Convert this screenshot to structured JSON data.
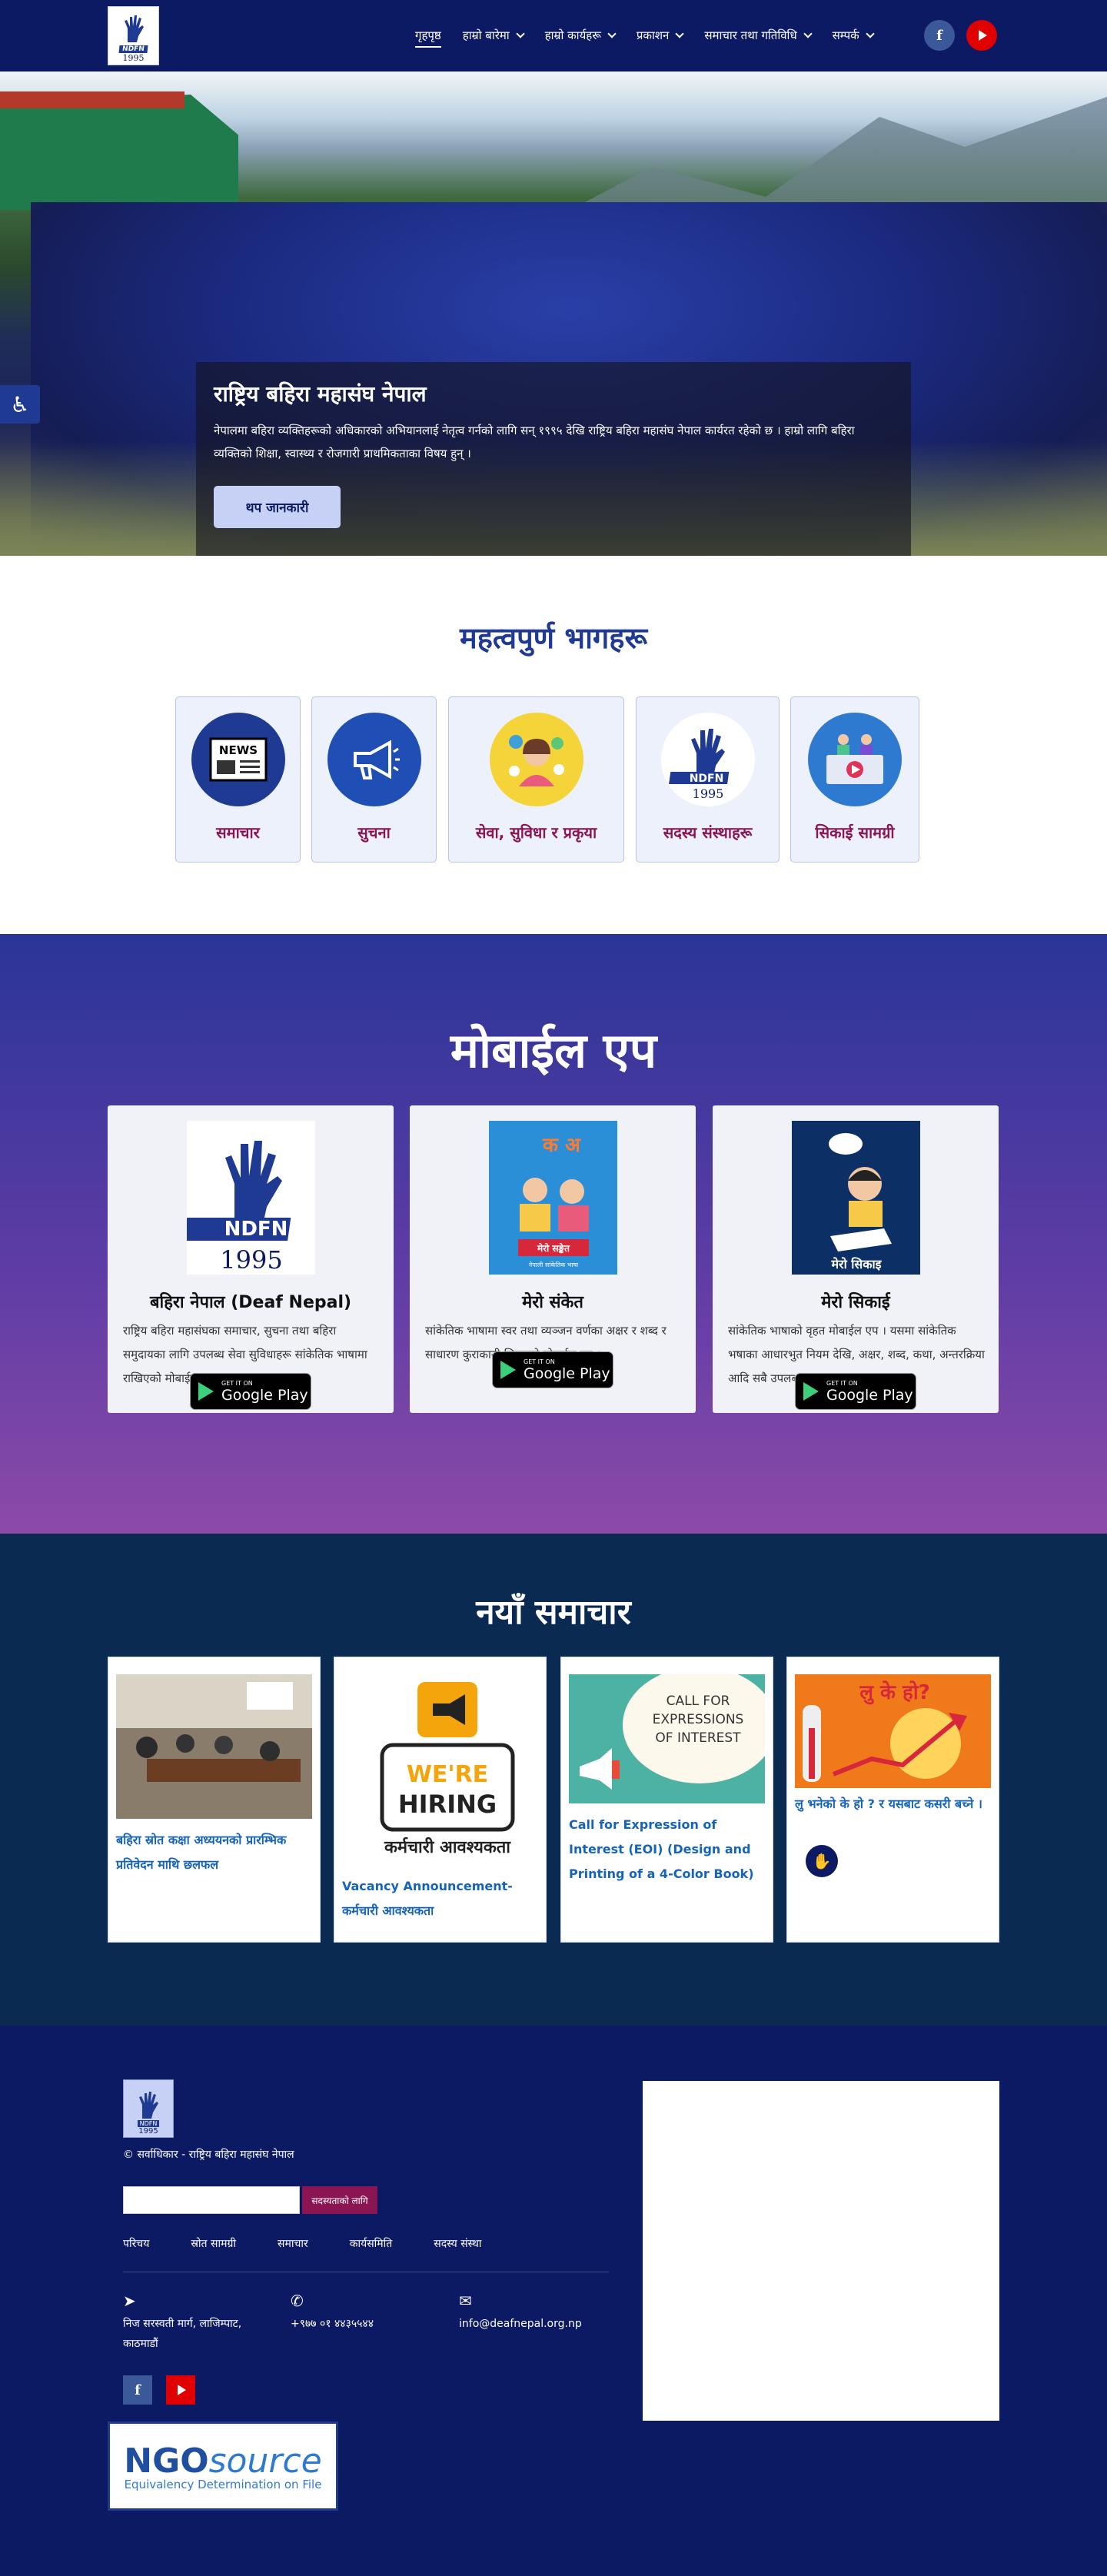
{
  "header": {
    "logo": {
      "badge": "NDFN",
      "year": "1995"
    },
    "nav": [
      {
        "label": "गृहपृष्ठ",
        "dropdown": false,
        "active": true
      },
      {
        "label": "हाम्रो बारेमा",
        "dropdown": true
      },
      {
        "label": "हाम्रो कार्यहरू",
        "dropdown": true
      },
      {
        "label": "प्रकाशन",
        "dropdown": true
      },
      {
        "label": "समाचार तथा गतिविधि",
        "dropdown": true
      },
      {
        "label": "सम्पर्क",
        "dropdown": true
      }
    ],
    "social": {
      "facebook": "f",
      "youtube": "youtube-icon"
    }
  },
  "hero": {
    "title": "राष्ट्रिय बहिरा महासंघ नेपाल",
    "text": "नेपालमा बहिरा व्यक्तिहरूको अधिकारको अभियानलाई नेतृत्व गर्नको लागि सन् १९९५ देखि राष्ट्रिय बहिरा महासंघ नेपाल कार्यरत रहेको छ । हाम्रो लागि बहिरा व्यक्तिको शिक्षा, स्वास्थ्य र रोजगारी प्राथमिकताका विषय हुन् ।",
    "button": "थप जानकारी"
  },
  "important": {
    "title": "महत्वपुर्ण भागहरू",
    "cards": [
      {
        "label": "समाचार",
        "icon": "news-icon",
        "inner": "NEWS"
      },
      {
        "label": "सुचना",
        "icon": "megaphone-icon"
      },
      {
        "label": "सेवा, सुविधा र प्रकृया",
        "icon": "support-icon"
      },
      {
        "label": "सदस्य संस्थाहरू",
        "icon": "ndfn-logo-icon",
        "inner": "NDFN",
        "year": "1995"
      },
      {
        "label": "सिकाई सामग्री",
        "icon": "learning-icon"
      }
    ]
  },
  "mobile": {
    "title": "मोबाईल एप",
    "apps": [
      {
        "name": "बहिरा नेपाल (Deaf Nepal)",
        "desc": "राष्ट्रिय बहिरा महासंघका समाचार, सुचना तथा बहिरा समुदायका लागि उपलब्ध सेवा सुविधाहरू सांकेतिक भाषामा राखिएको मोबाईल एप ।",
        "img_text": "NDFN",
        "img_year": "1995"
      },
      {
        "name": "मेरो संकेत",
        "desc": "सांकेतिक भाषामा स्वर तथा व्यञ्जन वर्णका अक्षर र शब्द र साधारण कुराकानी सिकाउने मोबाईल एप ।",
        "img_text": "मेरो सङ्केत",
        "img_sub": "नेपाली सांकेतिक भाषा",
        "img_letters": "क अ"
      },
      {
        "name": "मेरो सिकाई",
        "desc": "सांकेतिक भाषाको वृहत मोबाईल एप । यसमा सांकेतिक भषाका आधारभुत नियम देखि, अक्षर, शब्द, कथा, अन्तरक्रिया आदि सबै उपलब्ध छ ।",
        "img_text": "मेरो सिकाइ"
      }
    ],
    "gplay_small": "GET IT ON",
    "gplay_big": "Google Play"
  },
  "news": {
    "title": "नयाँ समाचार",
    "items": [
      {
        "title": "बहिरा स्रोत कक्षा अध्ययनको प्रारम्भिक प्रतिवेदन माथि छलफल"
      },
      {
        "title": "Vacancy Announcement-कर्मचारी आवश्यकता",
        "img_line1": "WE'RE",
        "img_line2": "HIRING",
        "img_line3": "कर्मचारी आवश्यकता"
      },
      {
        "title": "Call for Expression of Interest (EOI) (Design and Printing of a 4-Color Book)",
        "img_text": "CALL FOR EXPRESSIONS OF INTEREST"
      },
      {
        "title": "लु भनेको के हो ? र यसबाट कसरी बच्ने ।",
        "img_text": "लु के हो?"
      }
    ]
  },
  "footer": {
    "copyright": "© सर्वाधिकार - राष्ट्रिय बहिरा महासंघ नेपाल",
    "search_placeholder": "",
    "submit": "सदस्यताको लागि",
    "links": [
      "परिचय",
      "स्रोत सामग्री",
      "समाचार",
      "कार्यसमिति",
      "सदस्य संस्था"
    ],
    "address": "निज सरस्वती मार्ग, लाजिम्पाट, काठमाडौं",
    "phone": "+९७७ ०१ ४४३५५४४",
    "email": "info@deafnepal.org.np",
    "ngo": {
      "brand1": "NGO",
      "brand2": "source",
      "tagline": "Equivalency Determination on File"
    }
  },
  "colors": {
    "navy": "#0c1a63",
    "accent": "#1f3a93",
    "maroon": "#8b1552",
    "link": "#1564b8"
  }
}
